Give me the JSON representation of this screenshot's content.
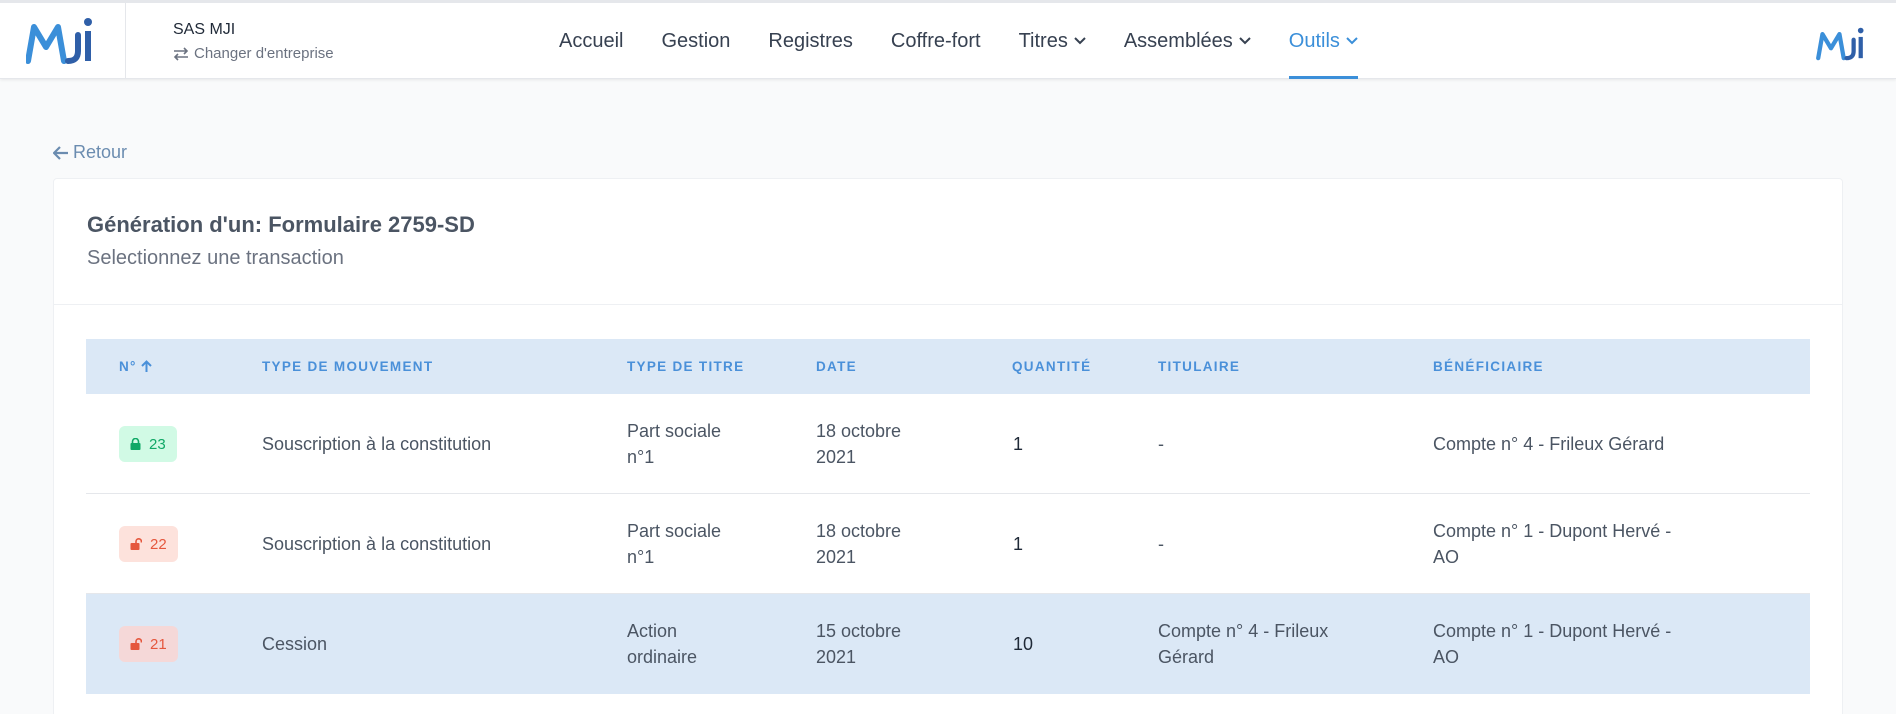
{
  "header": {
    "company_name": "SAS MJI",
    "switch_label": "Changer d'entreprise",
    "nav": [
      {
        "label": "Accueil"
      },
      {
        "label": "Gestion"
      },
      {
        "label": "Registres"
      },
      {
        "label": "Coffre-fort"
      },
      {
        "label": "Titres"
      },
      {
        "label": "Assemblées"
      },
      {
        "label": "Outils"
      }
    ],
    "active_nav": "Outils",
    "logo_text": "MJI"
  },
  "back_label": "Retour",
  "card": {
    "title": "Génération d'un: Formulaire 2759-SD",
    "subtitle": "Selectionnez une transaction"
  },
  "table": {
    "columns": {
      "num": "N°",
      "movement": "TYPE DE MOUVEMENT",
      "title_type": "TYPE DE TITRE",
      "date": "DATE",
      "qty": "QUANTITÉ",
      "holder": "TITULAIRE",
      "beneficiary": "BÉNÉFICIAIRE"
    },
    "sort_icon": "arrow-up-icon",
    "rows": [
      {
        "num": "23",
        "status": "locked",
        "movement": "Souscription à la constitution",
        "title_type_1": "Part sociale",
        "title_type_2": "n°1",
        "date_1": "18 octobre",
        "date_2": "2021",
        "qty": "1",
        "holder_1": "-",
        "holder_2": "",
        "beneficiary_1": "Compte n° 4 - Frileux Gérard",
        "beneficiary_2": ""
      },
      {
        "num": "22",
        "status": "unlocked",
        "movement": "Souscription à la constitution",
        "title_type_1": "Part sociale",
        "title_type_2": "n°1",
        "date_1": "18 octobre",
        "date_2": "2021",
        "qty": "1",
        "holder_1": "-",
        "holder_2": "",
        "beneficiary_1": "Compte n° 1 - Dupont Hervé -",
        "beneficiary_2": "AO"
      },
      {
        "num": "21",
        "status": "unlocked",
        "movement": "Cession",
        "title_type_1": "Action",
        "title_type_2": "ordinaire",
        "date_1": "15 octobre",
        "date_2": "2021",
        "qty": "10",
        "holder_1": "Compte n° 4 - Frileux",
        "holder_2": "Gérard",
        "beneficiary_1": "Compte n° 1 - Dupont Hervé -",
        "beneficiary_2": "AO"
      }
    ]
  },
  "colors": {
    "accent": "#3b8fd9",
    "header_row": "#dbe8f6",
    "locked_badge": "#d1fae5",
    "unlocked_badge": "#fde2dc"
  }
}
